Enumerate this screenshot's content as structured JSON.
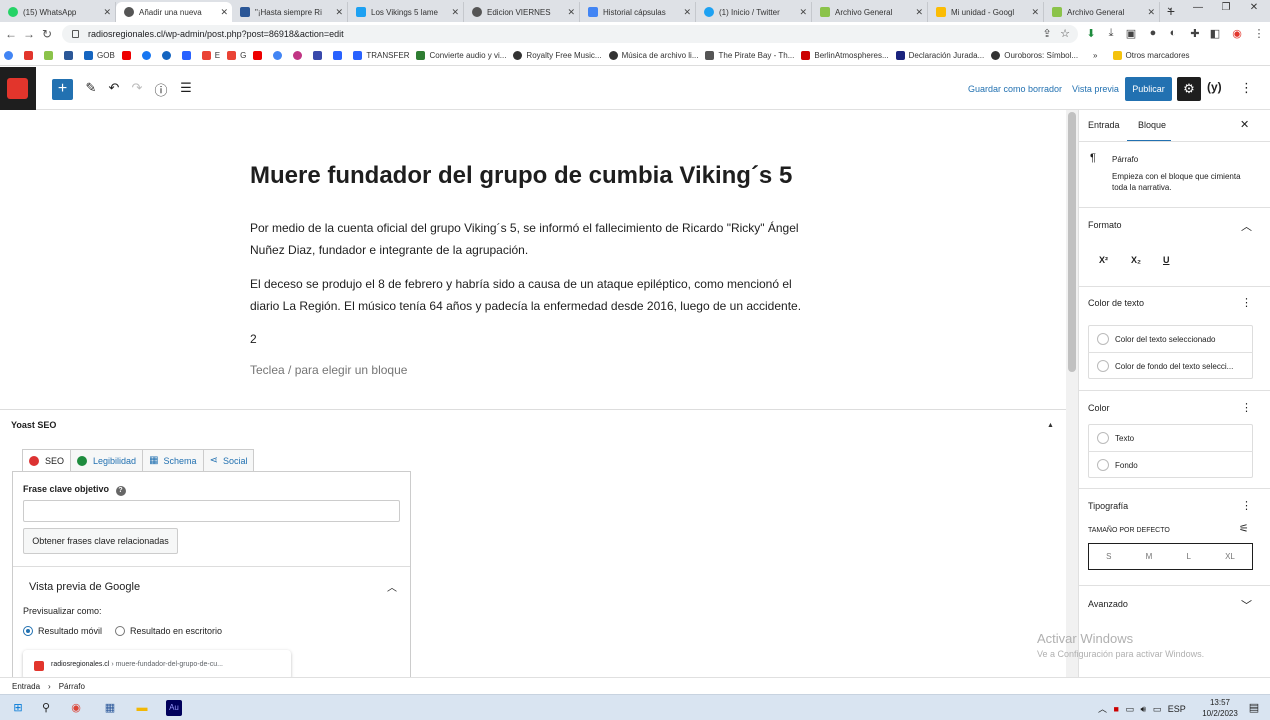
{
  "browser": {
    "tabs": [
      {
        "label": "(15) WhatsApp",
        "color": "#25d366"
      },
      {
        "label": "Añadir una nueva",
        "color": "#555555"
      },
      {
        "label": "\"¡Hasta siempre Ri",
        "color": "#2b5797"
      },
      {
        "label": "Los Vikings 5 lame",
        "color": "#1da1f2"
      },
      {
        "label": "Edicion VIERNES",
        "color": "#555555"
      },
      {
        "label": "Historial cápsulas",
        "color": "#4285f4"
      },
      {
        "label": "(1) Inicio / Twitter",
        "color": "#1da1f2"
      },
      {
        "label": "Archivo General",
        "color": "#8bc34a"
      },
      {
        "label": "Mi unidad - Googl",
        "color": "#fbbc04"
      },
      {
        "label": "Archivo General",
        "color": "#8bc34a"
      }
    ],
    "url": "radiosregionales.cl/wp-admin/post.php?post=86918&action=edit",
    "bookmarks": [
      {
        "label": "GOB",
        "color": "#1565c0"
      },
      {
        "label": "E",
        "color": "#ea4335"
      },
      {
        "label": "G",
        "color": "#ea4335"
      },
      {
        "label": "TRANSFER",
        "color": "#2962ff"
      },
      {
        "label": "Convierte audio y vi...",
        "color": "#2e7d32"
      },
      {
        "label": "Royalty Free Music...",
        "color": "#333333"
      },
      {
        "label": "Música de archivo li...",
        "color": "#333333"
      },
      {
        "label": "The Pirate Bay - Th...",
        "color": "#555555"
      },
      {
        "label": "BerlinAtmospheres...",
        "color": "#cc0000"
      },
      {
        "label": "Declaración Jurada...",
        "color": "#1a237e"
      },
      {
        "label": "Ouroboros: Símbol...",
        "color": "#333333"
      },
      {
        "label": "»",
        "color": ""
      },
      {
        "label": "Otros marcadores",
        "color": "#f4c20d"
      }
    ]
  },
  "toolbar": {
    "save_draft": "Guardar como borrador",
    "preview": "Vista previa",
    "publish": "Publicar",
    "yoast": "(y)"
  },
  "post": {
    "title": "Muere fundador del grupo de cumbia Viking´s 5",
    "paragraphs": [
      "Por medio de la cuenta oficial del grupo Viking´s 5, se informó el fallecimiento de Ricardo \"Ricky\" Ángel Nuñez Diaz, fundador e integrante de la agrupación.",
      "El deceso se produjo el 8 de febrero y habría sido a causa de un ataque epiléptico, como mencionó el diario La Región. El músico tenía 64 años y padecía la enfermedad desde 2016, luego de un accidente.",
      "2"
    ],
    "placeholder": "Teclea / para elegir un bloque"
  },
  "yoast": {
    "title": "Yoast SEO",
    "tabs": [
      {
        "label": "SEO",
        "color": "#dc3232"
      },
      {
        "label": "Legibilidad",
        "color": "#1e8c3e"
      },
      {
        "label": "Schema",
        "color": "#2271b1"
      },
      {
        "label": "Social",
        "color": "#2271b1"
      }
    ],
    "keyphrase_label": "Frase clave objetivo",
    "keyphrase_value": "",
    "related_button": "Obtener frases clave relacionadas",
    "google_preview_title": "Vista previa de Google",
    "preview_as": "Previsualizar como:",
    "radio_mobile": "Resultado móvil",
    "radio_desktop": "Resultado en escritorio",
    "snippet_site": "radiosregionales.cl",
    "snippet_path": "› muere-fundador-del-grupo-de-cu..."
  },
  "sidebar": {
    "tab_entrada": "Entrada",
    "tab_bloque": "Bloque",
    "block_name": "Párrafo",
    "block_desc": "Empieza con el bloque que cimienta toda la narrativa.",
    "formato": "Formato",
    "fmt_sup": "X²",
    "fmt_sub": "X₂",
    "fmt_u": "U",
    "text_color_title": "Color de texto",
    "text_color_opt1": "Color del texto seleccionado",
    "text_color_opt2": "Color de fondo del texto selecci...",
    "color_title": "Color",
    "color_opt1": "Texto",
    "color_opt2": "Fondo",
    "typography_title": "Tipografía",
    "size_label": "TAMAÑO POR DEFECTO",
    "sizes": [
      "S",
      "M",
      "L",
      "XL"
    ],
    "advanced": "Avanzado"
  },
  "watermark": {
    "line1": "Activar Windows",
    "line2": "Ve a Configuración para activar Windows."
  },
  "breadcrumb": {
    "root": "Entrada",
    "sep": "›",
    "current": "Párrafo"
  },
  "taskbar": {
    "lang": "ESP",
    "time": "13:57",
    "date": "10/2/2023"
  }
}
